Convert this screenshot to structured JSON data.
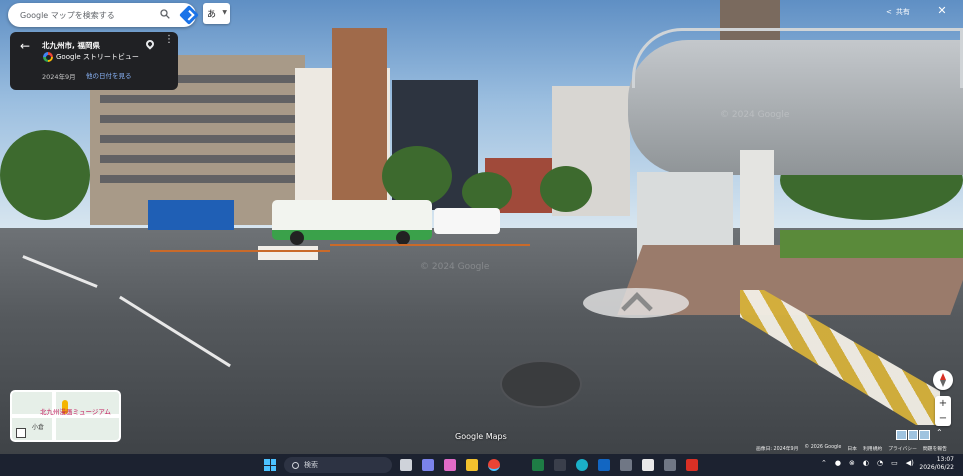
{
  "search": {
    "placeholder": "Google マップを検索する"
  },
  "ime": {
    "label": "あ"
  },
  "info_card": {
    "title": "北九州市, 福岡県",
    "source": "Google ストリートビュー",
    "date": "2024年9月",
    "other_dates_link": "他の日付を見る"
  },
  "toolbar": {
    "share_label": "共有"
  },
  "overlay": {
    "google_maps_label": "Google Maps",
    "watermark": "© 2024 Google"
  },
  "minimap": {
    "label": "北九州漫画ミュージアム",
    "label_short": "小倉"
  },
  "attribution": {
    "image_date": "画像日: 2024年9月",
    "copyright": "© 2026 Google",
    "country": "日本",
    "terms": "利用規約",
    "privacy": "プライバシー",
    "report": "問題を報告"
  },
  "taskbar": {
    "search_placeholder": "検索",
    "time": "13:07",
    "date": "2026/06/22"
  },
  "colors": {
    "accent": "#1a73e8",
    "card_bg": "#202124",
    "link": "#8ab4f8",
    "taskbar": "#1c2230"
  }
}
